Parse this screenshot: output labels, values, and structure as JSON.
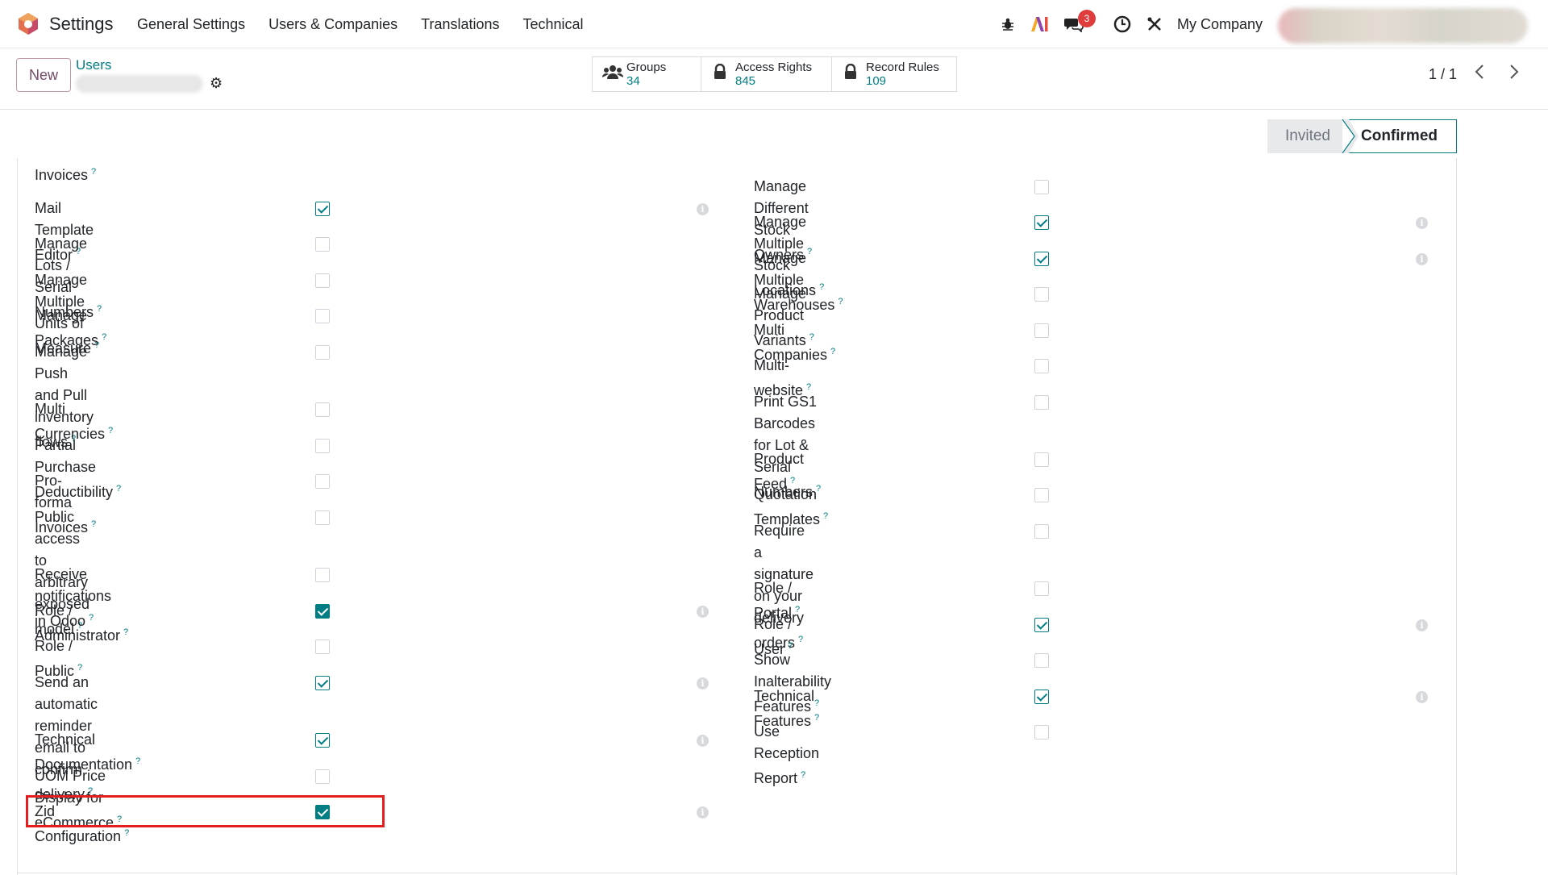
{
  "navbar": {
    "app_name": "Settings",
    "menu": [
      "General Settings",
      "Users & Companies",
      "Translations",
      "Technical"
    ],
    "message_count": "3",
    "company": "My Company"
  },
  "control_panel": {
    "new_label": "New",
    "breadcrumb": "Users",
    "smart_buttons": [
      {
        "label": "Groups",
        "value": "34"
      },
      {
        "label": "Access Rights",
        "value": "845"
      },
      {
        "label": "Record Rules",
        "value": "109"
      }
    ],
    "pager": "1 / 1"
  },
  "status": {
    "invited": "Invited",
    "confirmed": "Confirmed"
  },
  "left_fields": [
    {
      "label": "Invoices",
      "checked": null,
      "info": false
    },
    {
      "label": "Mail Template Editor",
      "checked": "check",
      "info": true
    },
    {
      "label": "Manage Lots / Serial Numbers",
      "checked": "off",
      "info": false
    },
    {
      "label": "Manage Multiple Units of Measure",
      "checked": "off",
      "info": false
    },
    {
      "label": "Manage Packages",
      "checked": "off",
      "info": false
    },
    {
      "label": "Manage Push and Pull inventory",
      "label2": "flows",
      "checked": "off",
      "info": false
    },
    {
      "label": "Multi Currencies",
      "checked": "off",
      "info": false
    },
    {
      "label": "Partial Purchase Deductibility",
      "checked": "off",
      "info": false
    },
    {
      "label": "Pro-forma Invoices",
      "checked": "off",
      "info": false
    },
    {
      "label": "Public access to arbitrary exposed",
      "label2": "model",
      "checked": "off",
      "info": false
    },
    {
      "label": "Receive notifications in Odoo",
      "checked": "off",
      "info": false
    },
    {
      "label": "Role / Administrator",
      "checked": "filled",
      "info": true
    },
    {
      "label": "Role / Public",
      "checked": "off",
      "info": false
    },
    {
      "label": "Send an automatic reminder email to",
      "label2": "confirm delivery",
      "checked": "check",
      "info": true
    },
    {
      "label": "Technical Documentation",
      "checked": "check",
      "info": true
    },
    {
      "label": "UOM Price Display for eCommerce",
      "checked": "off",
      "info": false
    },
    {
      "label": "Zid Configuration",
      "checked": "filled",
      "info": true
    }
  ],
  "right_fields": [
    {
      "label": "Manage Different Stock Owners",
      "checked": "off",
      "info": false
    },
    {
      "label": "Manage Multiple Stock Locations",
      "checked": "check",
      "info": true
    },
    {
      "label": "Manage Multiple Warehouses",
      "checked": "check",
      "info": true
    },
    {
      "label": "Manage Product Variants",
      "checked": "off",
      "info": false
    },
    {
      "label": "Multi Companies",
      "checked": "off",
      "info": false
    },
    {
      "label": "Multi-website",
      "checked": "off",
      "info": false
    },
    {
      "label": "Print GS1 Barcodes for Lot & Serial",
      "label2": "Numbers",
      "checked": "off",
      "info": false
    },
    {
      "label": "Product Feed",
      "checked": "off",
      "info": false
    },
    {
      "label": "Quotation Templates",
      "checked": "off",
      "info": false
    },
    {
      "label": "Require a signature on your delivery",
      "label2": "orders",
      "checked": "off",
      "info": false
    },
    {
      "label": "Role / Portal",
      "checked": "off",
      "info": false
    },
    {
      "label": "Role / User",
      "checked": "check",
      "info": true
    },
    {
      "label": "Show Inalterability Features",
      "checked": "off",
      "info": false
    },
    {
      "label": "Technical Features",
      "checked": "check",
      "info": true
    },
    {
      "label": "Use Reception Report",
      "checked": "off",
      "info": false
    }
  ],
  "colors": {
    "primary": "#714b67",
    "teal": "#017e84",
    "highlight": "#e41e1e"
  }
}
